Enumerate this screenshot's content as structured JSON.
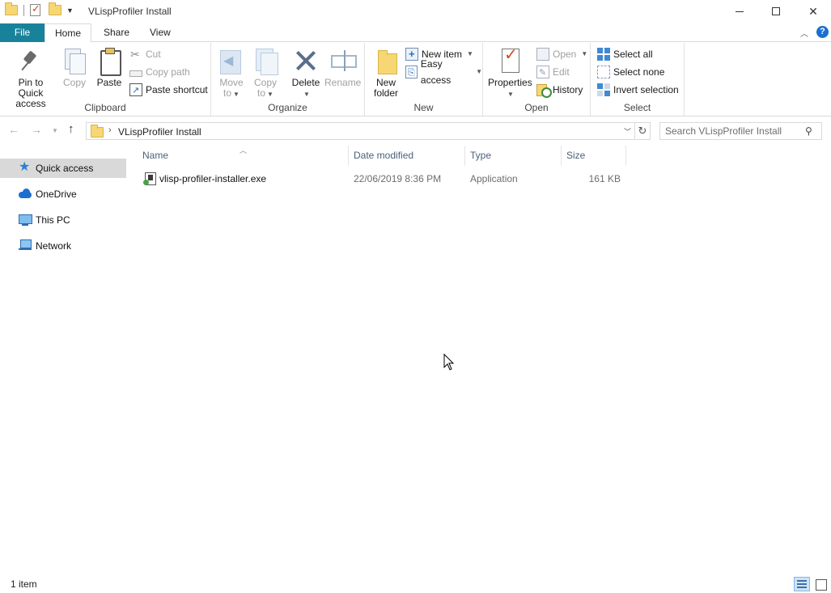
{
  "window": {
    "title": "VLispProfiler Install"
  },
  "ribbon": {
    "tabs": [
      {
        "label": "File"
      },
      {
        "label": "Home"
      },
      {
        "label": "Share"
      },
      {
        "label": "View"
      }
    ],
    "help": "?",
    "groups": {
      "clipboard": {
        "label": "Clipboard",
        "pin_line1": "Pin to Quick",
        "pin_line2": "access",
        "copy": "Copy",
        "paste": "Paste",
        "cut": "Cut",
        "copy_path": "Copy path",
        "paste_shortcut": "Paste shortcut"
      },
      "organize": {
        "label": "Organize",
        "move_line1": "Move",
        "move_line2": "to",
        "copy_line1": "Copy",
        "copy_line2": "to",
        "delete": "Delete",
        "rename": "Rename"
      },
      "new": {
        "label": "New",
        "new_folder_line1": "New",
        "new_folder_line2": "folder",
        "new_item": "New item",
        "easy_access": "Easy access"
      },
      "open": {
        "label": "Open",
        "properties": "Properties",
        "open": "Open",
        "edit": "Edit",
        "history": "History"
      },
      "select": {
        "label": "Select",
        "select_all": "Select all",
        "select_none": "Select none",
        "invert_selection": "Invert selection"
      }
    }
  },
  "address_bar": {
    "path": "VLispProfiler Install",
    "search_placeholder": "Search VLispProfiler Install"
  },
  "nav_pane": {
    "items": [
      {
        "label": "Quick access",
        "icon": "star-icon",
        "selected": true
      },
      {
        "label": "OneDrive",
        "icon": "cloud-icon"
      },
      {
        "label": "This PC",
        "icon": "computer-icon"
      },
      {
        "label": "Network",
        "icon": "network-icon"
      }
    ]
  },
  "file_list": {
    "columns": [
      "Name",
      "Date modified",
      "Type",
      "Size"
    ],
    "rows": [
      {
        "name": "vlisp-profiler-installer.exe",
        "date": "22/06/2019 8:36 PM",
        "type": "Application",
        "size": "161 KB"
      }
    ]
  },
  "status_bar": {
    "item_count": "1 item"
  },
  "colors": {
    "file_tab": "#19829b",
    "selection": "#d9d9d9",
    "header_text": "#4c607a",
    "accent": "#1a6fd1"
  }
}
